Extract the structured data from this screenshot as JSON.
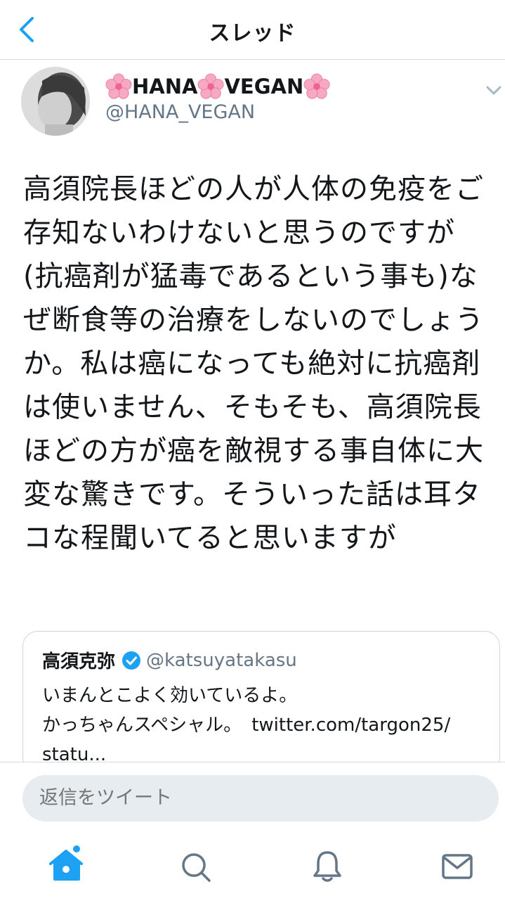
{
  "header": {
    "title": "スレッド",
    "back_icon": "chevron-left-icon"
  },
  "tweet": {
    "display_name": "HANA",
    "display_name_2": "VEGAN",
    "name_decoration_icon": "cherry-blossom-icon",
    "handle": "@HANA_VEGAN",
    "text": "高須院長ほどの人が人体の免疫をご存知ないわけないと思うのですが(抗癌剤が猛毒であるという事も)なぜ断食等の治療をしないのでしょうか。私は癌になっても絶対に抗癌剤は使いません、そもそも、高須院長ほどの方が癌を敵視する事自体に大変な驚きです。そういった話は耳タコな程聞いてると思いますが"
  },
  "quote": {
    "name": "高須克弥",
    "handle": "@katsuyatakasu",
    "line1": "いまんとこよく効いているよ。",
    "line2": "かっちゃんスペシャル。",
    "link": "twitter.com/targon25/",
    "line3": "statu..."
  },
  "reply": {
    "placeholder": "返信をツイート"
  },
  "tabbar": {
    "items": [
      "home-icon",
      "search-icon",
      "notifications-icon",
      "messages-icon"
    ],
    "active": "home-icon",
    "accent_color": "#1da1f2"
  },
  "colors": {
    "accent": "#1da1f2",
    "secondary_text": "#657786",
    "border": "#ccd6dd"
  }
}
